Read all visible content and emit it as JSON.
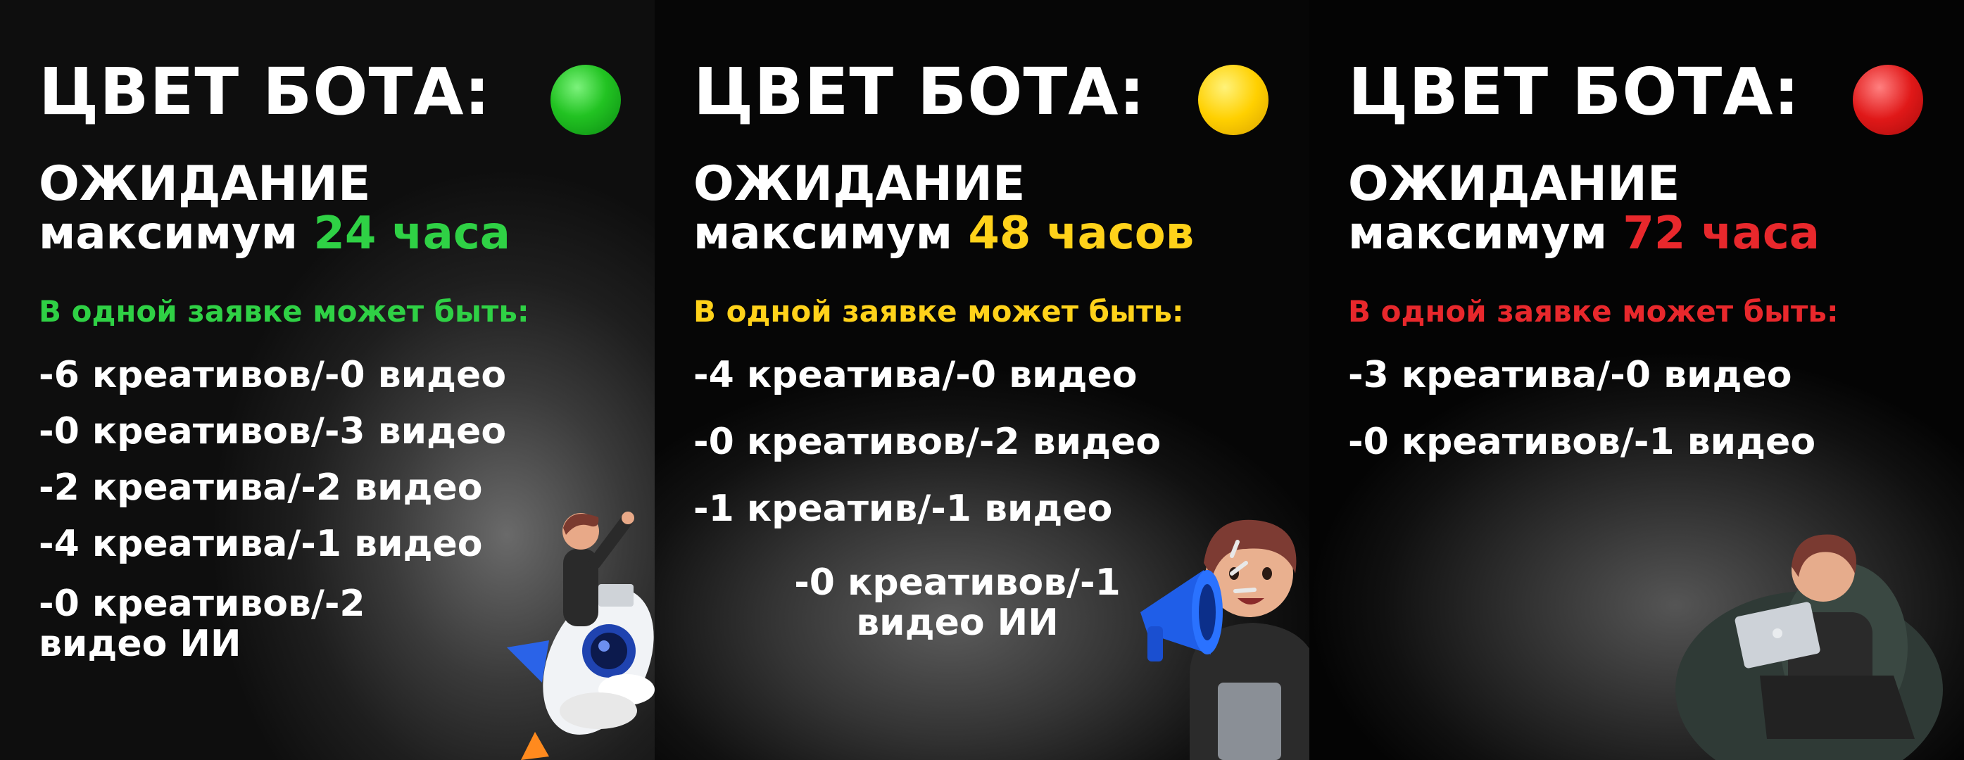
{
  "panels": [
    {
      "title": "ЦВЕТ БОТА:",
      "dot_color": "#1ec01e",
      "wait_label": "ОЖИДАНИЕ",
      "wait_prefix": "максимум",
      "wait_value": "24 часа",
      "accent": "#2fd145",
      "subtitle": "В одной заявке может быть:",
      "items": [
        "-6  креативов/-0 видео",
        "-0  креативов/-3 видео",
        "-2  креатива/-2 видео",
        "-4  креатива/-1 видео",
        "-0  креативов/-2 видео ИИ"
      ]
    },
    {
      "title": "ЦВЕТ БОТА:",
      "dot_color": "#ffd400",
      "wait_label": "ОЖИДАНИЕ",
      "wait_prefix": "максимум",
      "wait_value": "48 часов",
      "accent": "#ffd21a",
      "subtitle": "В одной заявке может быть:",
      "items": [
        "-4  креатива/-0 видео",
        "-0  креативов/-2 видео",
        "-1 креатив/-1 видео",
        "-0  креативов/-1 видео ИИ"
      ]
    },
    {
      "title": "ЦВЕТ БОТА:",
      "dot_color": "#e01818",
      "wait_label": "ОЖИДАНИЕ",
      "wait_prefix": "максимум",
      "wait_value": "72 часа",
      "accent": "#e8282c",
      "subtitle": "В одной заявке может быть:",
      "items": [
        "-3  креатива/-0 видео",
        "-0  креативов/-1 видео"
      ]
    }
  ]
}
